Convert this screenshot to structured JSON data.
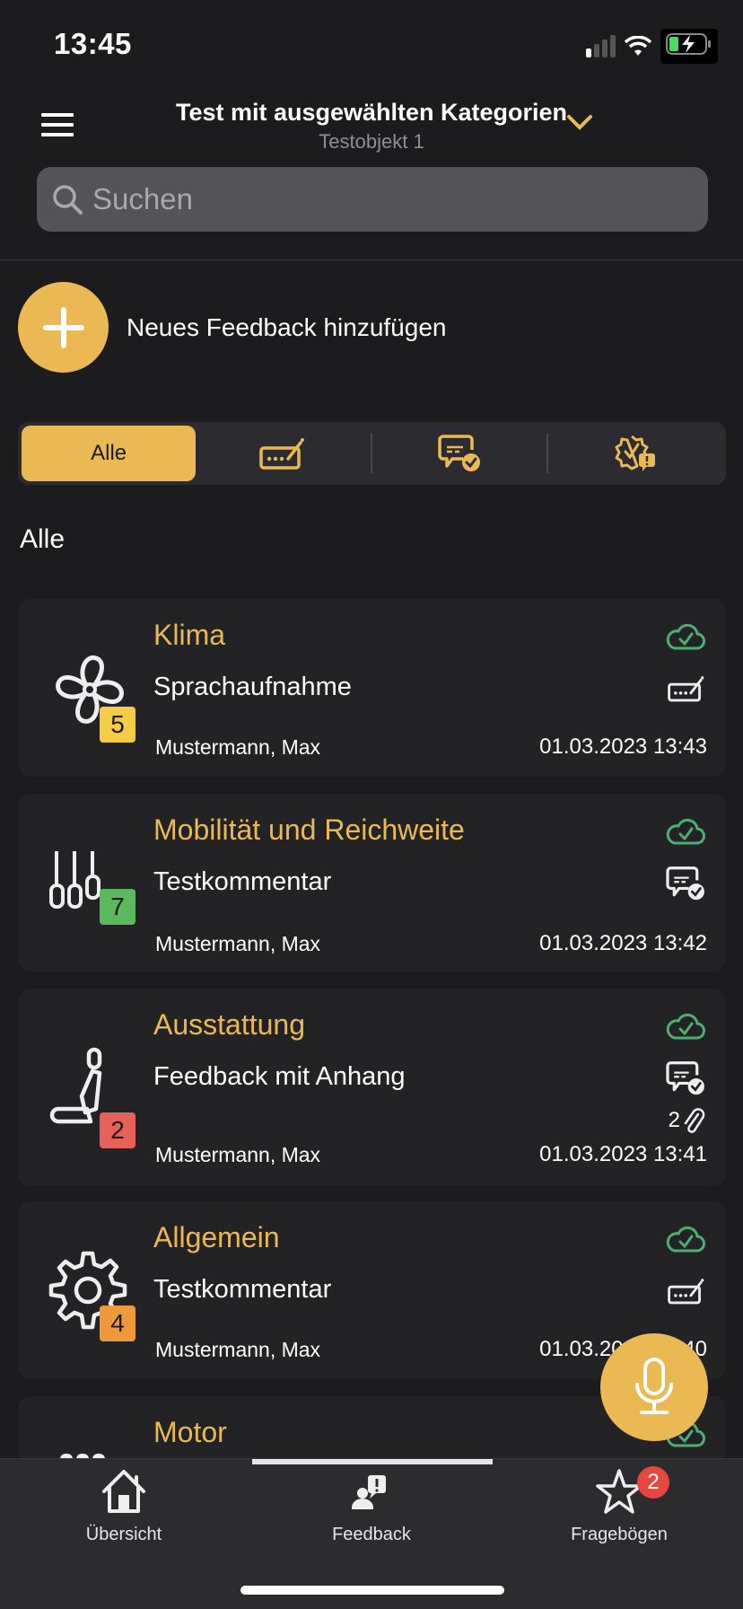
{
  "status_bar": {
    "time": "13:45",
    "signal_bars": 1
  },
  "header": {
    "title": "Test mit ausgewählten Kategorien",
    "subtitle": "Testobjekt 1",
    "search_placeholder": "Suchen",
    "search_value": ""
  },
  "add_feedback": {
    "label": "Neues Feedback hinzufügen"
  },
  "filter": {
    "segments": [
      {
        "label": "Alle",
        "icon": "text-input-icon",
        "active": true
      },
      {
        "label": "",
        "icon": "text-input-icon",
        "active": false
      },
      {
        "label": "",
        "icon": "comment-check-icon",
        "active": false
      },
      {
        "label": "",
        "icon": "badge-alert-icon",
        "active": false
      }
    ]
  },
  "section_title": "Alle",
  "feedback_items": [
    {
      "category": "Klima",
      "description": "Sprachaufnahme",
      "user": "Mustermann, Max",
      "date": "01.03.2023 13:43",
      "rating": "5",
      "rating_color": "#f4cc48",
      "category_icon": "fan-icon",
      "type_icon": "text-input-icon",
      "synced": true,
      "attachments": null
    },
    {
      "category": "Mobilität und Reichweite",
      "description": "Testkommentar",
      "user": "Mustermann, Max",
      "date": "01.03.2023 13:42",
      "rating": "7",
      "rating_color": "#5cb85c",
      "category_icon": "gear-shift-icon",
      "type_icon": "comment-check-icon",
      "synced": true,
      "attachments": null
    },
    {
      "category": "Ausstattung",
      "description": "Feedback mit Anhang",
      "user": "Mustermann, Max",
      "date": "01.03.2023 13:41",
      "rating": "2",
      "rating_color": "#e5625a",
      "category_icon": "seat-icon",
      "type_icon": "comment-check-icon",
      "synced": true,
      "attachments": "2"
    },
    {
      "category": "Allgemein",
      "description": "Testkommentar",
      "user": "Mustermann, Max",
      "date": "01.03.2023 13:40",
      "rating": "4",
      "rating_color": "#ef9a3a",
      "category_icon": "gear-icon",
      "type_icon": "text-input-icon",
      "synced": true,
      "attachments": null
    },
    {
      "category": "Motor",
      "description": "",
      "user": "",
      "date": "",
      "rating": "",
      "rating_color": "",
      "category_icon": "engine-icon",
      "type_icon": "",
      "synced": true,
      "attachments": null
    }
  ],
  "tabbar": {
    "tabs": [
      {
        "label": "Übersicht",
        "icon": "home-icon",
        "active": false
      },
      {
        "label": "Feedback",
        "icon": "feedback-icon",
        "active": true
      },
      {
        "label": "Fragebögen",
        "icon": "star-icon",
        "active": false,
        "badge": "2"
      }
    ]
  },
  "colors": {
    "accent": "#ebb954",
    "synced": "#4caf72",
    "background": "#1c1c1e",
    "card": "#232325"
  }
}
